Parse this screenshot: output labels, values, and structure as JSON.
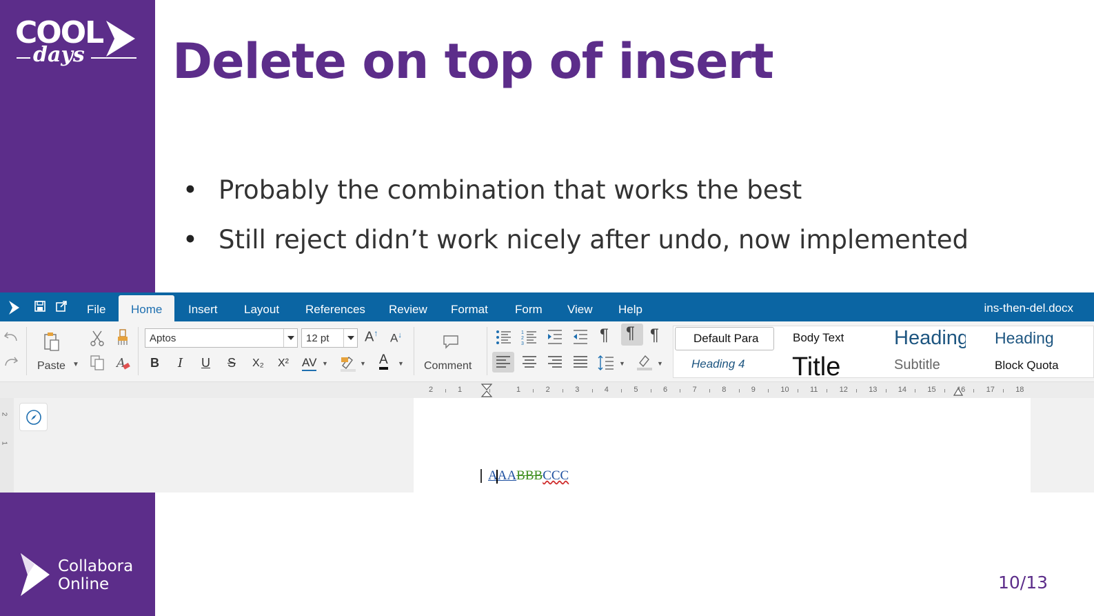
{
  "slide": {
    "title": "Delete on top of insert",
    "bullets": [
      "Probably the combination that works the best",
      "Still reject didn’t work nicely after undo, now implemented"
    ],
    "page_number": "10/13",
    "colors": {
      "brand_purple": "#5c2d8a",
      "menubar_blue": "#0b65a3"
    }
  },
  "logos": {
    "conference": {
      "word1": "COOL",
      "word2": "days"
    },
    "company": {
      "line1": "Collabora",
      "line2": "Online"
    }
  },
  "app": {
    "menu": [
      "File",
      "Home",
      "Insert",
      "Layout",
      "References",
      "Review",
      "Format",
      "Form",
      "View",
      "Help"
    ],
    "active_menu": "Home",
    "document_name": "ins-then-del.docx",
    "toolbar": {
      "paste_label": "Paste",
      "font_name": "Aptos",
      "font_size": "12 pt",
      "comment_label": "Comment",
      "bold": "B",
      "italic": "I",
      "underline": "U",
      "strike": "S",
      "subscript": "X₂",
      "superscript": "X²",
      "spacing": "AV",
      "font_color": "A",
      "grow": "A↑",
      "shrink": "A↓"
    },
    "styles": [
      "Default Para",
      "Body Text",
      "Heading",
      "Heading",
      "Heading 4",
      "Title",
      "Subtitle",
      "Block Quota"
    ],
    "ruler_numbers": [
      "2",
      "1",
      "1",
      "2",
      "3",
      "4",
      "5",
      "6",
      "7",
      "8",
      "9",
      "10",
      "11",
      "12",
      "13",
      "14",
      "15",
      "16",
      "17",
      "18"
    ],
    "vertical_ruler_numbers": [
      "2",
      "1"
    ],
    "document_text": {
      "inserted": "AAA",
      "deleted": "BBB",
      "remaining": "CCC"
    }
  }
}
